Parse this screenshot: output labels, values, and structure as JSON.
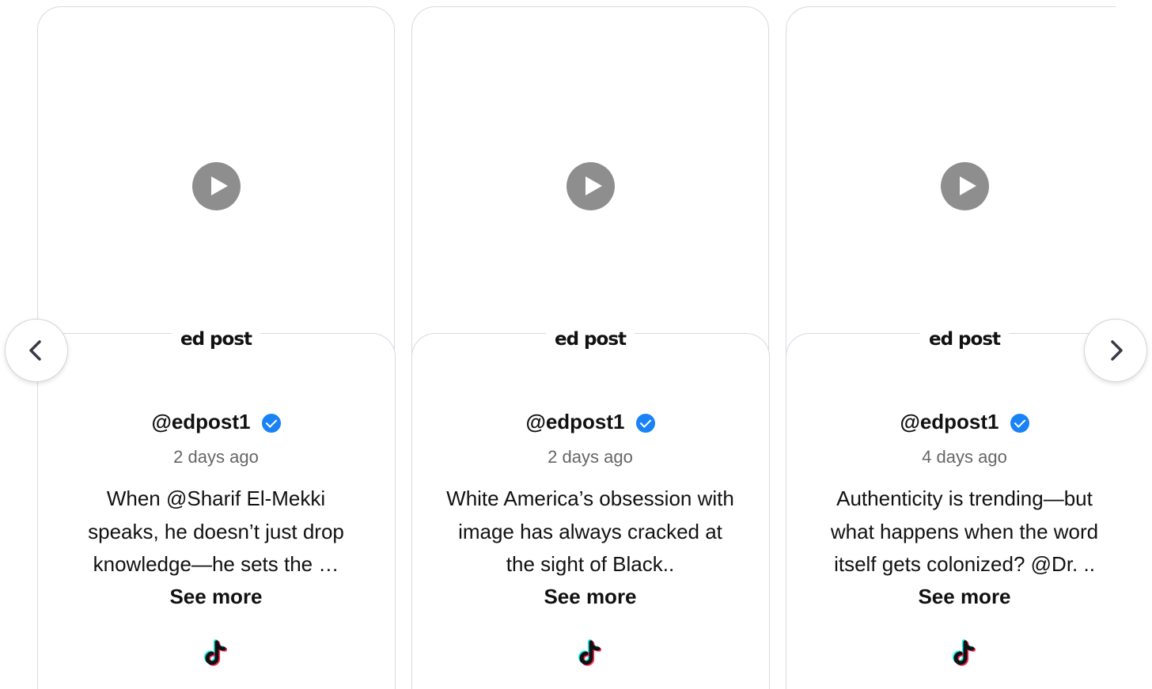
{
  "carousel": {
    "cards": [
      {
        "logo": "ed post",
        "handle": "@edpost1",
        "time": "2 days ago",
        "caption": "When @Sharif El-Mekki speaks, he doesn’t just drop knowledge—he sets the …",
        "see_more": "See more"
      },
      {
        "logo": "ed post",
        "handle": "@edpost1",
        "time": "2 days ago",
        "caption": "White America’s obsession with image has always cracked at the sight of Black..",
        "see_more": "See more"
      },
      {
        "logo": "ed post",
        "handle": "@edpost1",
        "time": "4 days ago",
        "caption": "Authenticity is trending—but what happens when the word itself gets colonized? @Dr. ..",
        "see_more": "See more"
      }
    ],
    "prev_icon": "chevron-left-icon",
    "next_icon": "chevron-right-icon"
  },
  "colors": {
    "verified": "#1a82f7",
    "play_button": "#8e8e8e",
    "border": "#d9dae2",
    "muted_text": "#666666",
    "tiktok_cyan": "#25f4ee",
    "tiktok_red": "#fe2c55"
  }
}
